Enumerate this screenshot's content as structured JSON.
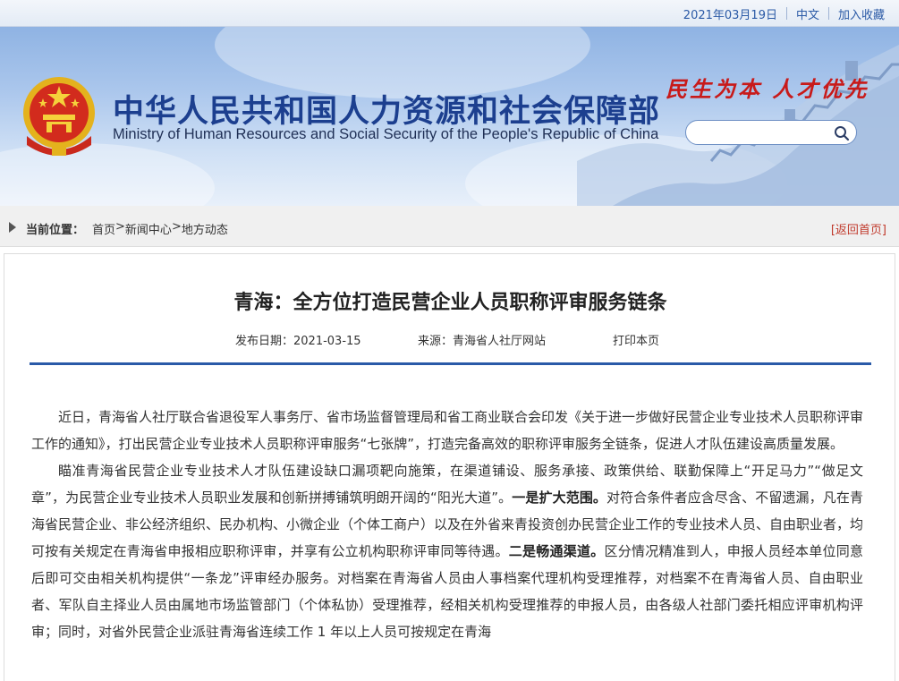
{
  "topbar": {
    "date": "2021年03月19日",
    "lang_link": "中文",
    "favorite_link": "加入收藏"
  },
  "header": {
    "title_cn": "中华人民共和国人力资源和社会保障部",
    "title_en": "Ministry of Human Resources and Social Security of the People's Republic of China",
    "slogan": "民生为本 人才优先",
    "search": {
      "placeholder": "",
      "value": ""
    }
  },
  "breadcrumb": {
    "label": "当前位置：",
    "items": [
      "首页",
      "新闻中心",
      "地方动态"
    ],
    "separator": ">",
    "back_link": "[返回首页]"
  },
  "article": {
    "title": "青海：全方位打造民营企业人员职称评审服务链条",
    "publish_date_label": "发布日期：",
    "publish_date": "2021-03-15",
    "source_label": "来源：",
    "source": "青海省人社厅网站",
    "print_link": "打印本页",
    "paragraphs": [
      "近日，青海省人社厅联合省退役军人事务厅、省市场监督管理局和省工商业联合会印发《关于进一步做好民营企业专业技术人员职称评审工作的通知》，打出民营企业专业技术人员职称评审服务“七张牌”，打造完备高效的职称评审服务全链条，促进人才队伍建设高质量发展。",
      "瞄准青海省民营企业专业技术人才队伍建设缺口漏项靶向施策，在渠道铺设、服务承接、政策供给、联勤保障上“开足马力”“做足文章”，为民营企业专业技术人员职业发展和创新拼搏铺筑明朗开阔的“阳光大道”。"
    ],
    "p2_bold1": "一是扩大范围。",
    "p2_rest1": "对符合条件者应含尽含、不留遗漏，凡在青海省民营企业、非公经济组织、民办机构、小微企业（个体工商户）以及在外省来青投资创办民营企业工作的专业技术人员、自由职业者，均可按有关规定在青海省申报相应职称评审，并享有公立机构职称评审同等待遇。",
    "p2_bold2": "二是畅通渠道。",
    "p2_rest2": "区分情况精准到人，申报人员经本单位同意后即可交由相关机构提供“一条龙”评审经办服务。对档案在青海省人员由人事档案代理机构受理推荐，对档案不在青海省人员、自由职业者、军队自主择业人员由属地市场监管部门（个体私协）受理推荐，经相关机构受理推荐的申报人员，由各级人社部门委托相应评审机构评审；同时，对省外民营企业派驻青海省连续工作 1 年以上人员可按规定在青海"
  },
  "colors": {
    "brand_blue": "#1c3f8f",
    "slogan_red": "#c81a1a",
    "rule_blue": "#2a5aa8",
    "link_red": "#c0392b"
  }
}
